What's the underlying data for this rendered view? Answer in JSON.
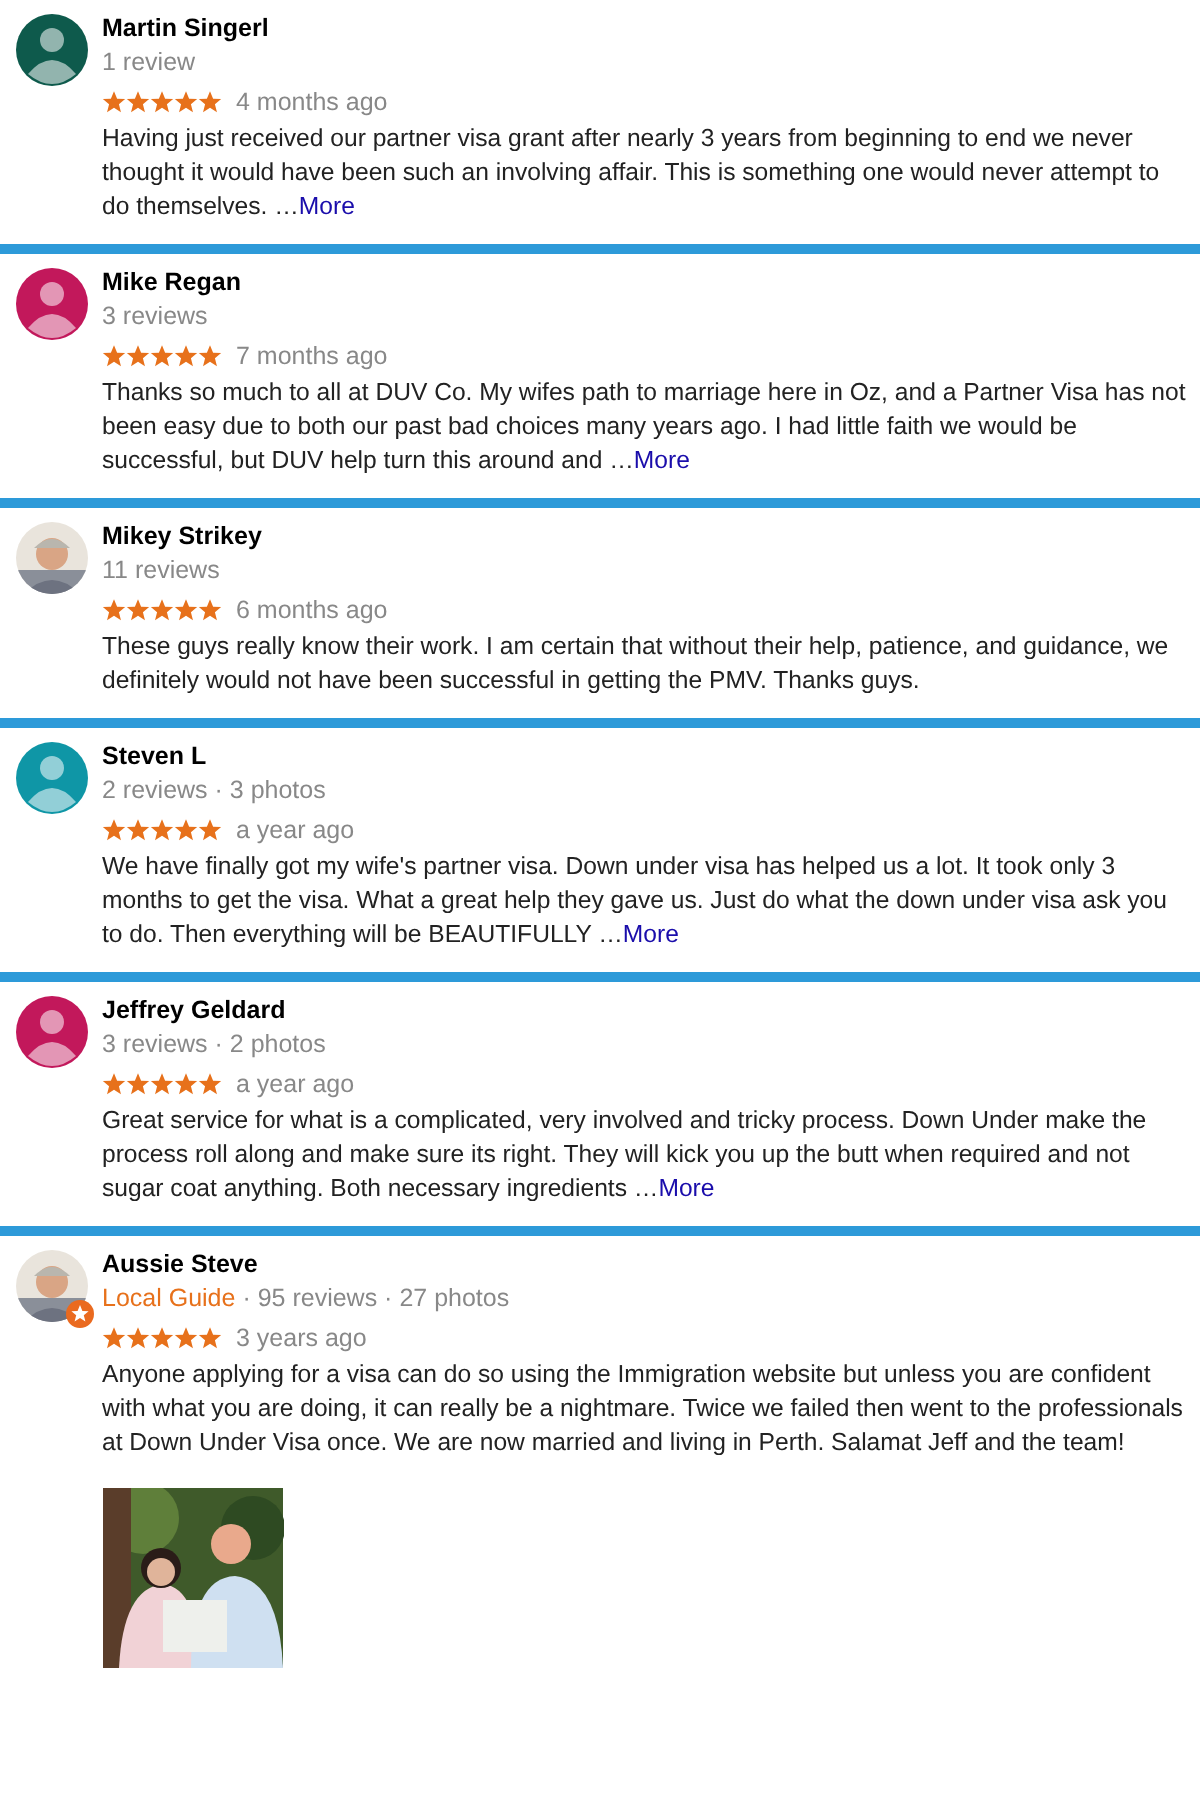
{
  "reviews": [
    {
      "name": "Martin Singerl",
      "avatar": {
        "kind": "default",
        "color": "#0e5a4c"
      },
      "meta": "1 review",
      "stars": 5,
      "time": "4 months ago",
      "text": "Having just received our partner visa grant after nearly 3 years from beginning to end we never thought it would have been such an involving affair. This is something one would never attempt to do themselves. …",
      "more": "More"
    },
    {
      "name": "Mike Regan",
      "avatar": {
        "kind": "default",
        "color": "#c2185b"
      },
      "meta": "3 reviews",
      "stars": 5,
      "time": "7 months ago",
      "text": "Thanks so much to all at DUV Co. My wifes path to marriage here in Oz, and a Partner Visa has not been easy due to both our past bad choices many years ago. I had little faith we would be successful, but DUV help turn this around and …",
      "more": "More"
    },
    {
      "name": "Mikey Strikey",
      "avatar": {
        "kind": "picture"
      },
      "meta": "11 reviews",
      "stars": 5,
      "time": "6 months ago",
      "text": "These guys really know their work. I am certain that without their help, patience, and guidance, we definitely would not have been successful in getting the PMV. Thanks guys."
    },
    {
      "name": "Steven L",
      "avatar": {
        "kind": "default",
        "color": "#0f96a6"
      },
      "meta": "2 reviews · 3 photos",
      "stars": 5,
      "time": "a year ago",
      "text": "We have finally got my wife's partner visa. Down under visa has helped us a lot. It took only 3 months to get the visa. What a great help they gave us. Just do what the down under visa ask you to do. Then everything will be BEAUTIFULLY …",
      "more": "More"
    },
    {
      "name": "Jeffrey Geldard",
      "avatar": {
        "kind": "default",
        "color": "#c2185b"
      },
      "meta": "3 reviews · 2 photos",
      "stars": 5,
      "time": "a year ago",
      "text": "Great service for what is a complicated, very involved and tricky process. Down Under make the process roll along and make sure its right. They will kick you up the butt when required and not sugar coat anything. Both necessary ingredients …",
      "more": "More"
    },
    {
      "name": "Aussie Steve",
      "avatar": {
        "kind": "picture"
      },
      "guide": "Local Guide",
      "meta": "· 95 reviews · 27 photos",
      "stars": 5,
      "time": "3 years ago",
      "text": "Anyone applying for a visa can do so using the Immigration website but unless you are confident with what you are doing, it can really be a nightmare. Twice we failed then went to the professionals at Down Under Visa once. We are now married and living in Perth. Salamat Jeff and the team!",
      "photos": [
        {
          "kind": "picture"
        }
      ]
    }
  ]
}
